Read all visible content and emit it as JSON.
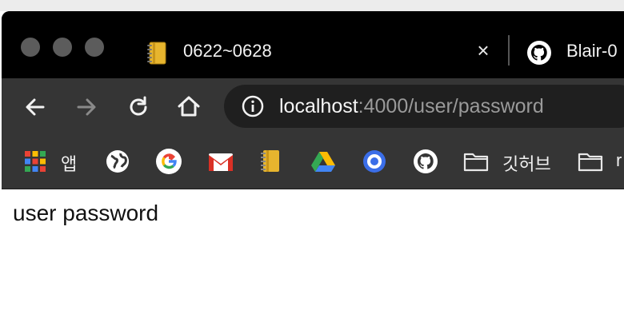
{
  "window": {
    "tabs": [
      {
        "title": "0622~0628",
        "icon": "notebook-icon",
        "active": true
      },
      {
        "title": "Blair-0",
        "icon": "github-icon",
        "active": false
      }
    ]
  },
  "toolbar": {
    "url_host": "localhost",
    "url_path": ":4000/user/password"
  },
  "bookmarks": [
    {
      "label": "앱",
      "icon": "apps-grid-icon"
    },
    {
      "label": "",
      "icon": "globe-icon"
    },
    {
      "label": "",
      "icon": "google-icon"
    },
    {
      "label": "",
      "icon": "gmail-icon"
    },
    {
      "label": "",
      "icon": "notebook-icon"
    },
    {
      "label": "",
      "icon": "google-drive-icon"
    },
    {
      "label": "",
      "icon": "blue-circle-icon"
    },
    {
      "label": "",
      "icon": "github-icon"
    },
    {
      "label": "깃허브",
      "icon": "folder-icon"
    },
    {
      "label": "r",
      "icon": "folder-icon"
    }
  ],
  "page": {
    "text": "user password"
  }
}
